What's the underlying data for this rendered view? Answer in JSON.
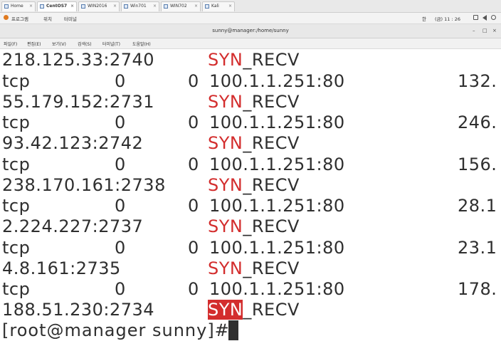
{
  "vm_tabs": [
    {
      "label": "Home",
      "active": false
    },
    {
      "label": "CentOS7",
      "active": true
    },
    {
      "label": "WIN2016",
      "active": false
    },
    {
      "label": "Win701",
      "active": false
    },
    {
      "label": "WIN702",
      "active": false
    },
    {
      "label": "Kali",
      "active": false
    }
  ],
  "gnome_bar": {
    "menu_programs": "프로그램",
    "menu_places": "위치",
    "menu_terminal": "터미널",
    "input_lang": "한",
    "clock": "(금) 11 : 26"
  },
  "window": {
    "title": "sunny@manager:/home/sunny",
    "minimize": "–",
    "maximize": "□",
    "close": "×"
  },
  "menubar": [
    "파일(F)",
    "편집(E)",
    "보기(V)",
    "검색(S)",
    "터미널(T)",
    "도움말(H)"
  ],
  "terminal": {
    "state_prefix": "SYN",
    "state_suffix": "_RECV",
    "rows": [
      {
        "addr": "218.125.33:2740"
      },
      {
        "proto": "tcp",
        "recvq": "0",
        "sendq": "0",
        "local": "100.1.1.251:80",
        "foreign_trunc": "132."
      },
      {
        "addr": "55.179.152:2731"
      },
      {
        "proto": "tcp",
        "recvq": "0",
        "sendq": "0",
        "local": "100.1.1.251:80",
        "foreign_trunc": "246."
      },
      {
        "addr": "93.42.123:2742"
      },
      {
        "proto": "tcp",
        "recvq": "0",
        "sendq": "0",
        "local": "100.1.1.251:80",
        "foreign_trunc": "156."
      },
      {
        "addr": "238.170.161:2738"
      },
      {
        "proto": "tcp",
        "recvq": "0",
        "sendq": "0",
        "local": "100.1.1.251:80",
        "foreign_trunc": "28.1"
      },
      {
        "addr": "2.224.227:2737"
      },
      {
        "proto": "tcp",
        "recvq": "0",
        "sendq": "0",
        "local": "100.1.1.251:80",
        "foreign_trunc": "23.1"
      },
      {
        "addr": "4.8.161:2735"
      },
      {
        "proto": "tcp",
        "recvq": "0",
        "sendq": "0",
        "local": "100.1.1.251:80",
        "foreign_trunc": "178."
      },
      {
        "addr": "188.51.230:2734"
      }
    ],
    "prompt": "[root@manager sunny]#"
  },
  "colors": {
    "syn_red": "#d32d2d",
    "text": "#2f2f2f",
    "background": "#ffffff"
  }
}
